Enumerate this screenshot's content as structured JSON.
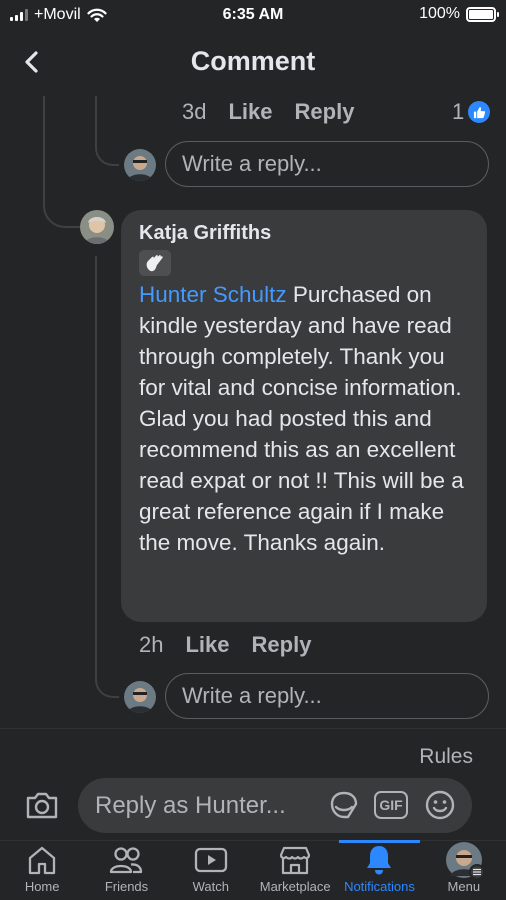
{
  "status_bar": {
    "carrier": "+Movil",
    "time": "6:35 AM",
    "battery": "100%"
  },
  "header": {
    "title": "Comment"
  },
  "prev_comment": {
    "time": "3d",
    "like_label": "Like",
    "reply_label": "Reply",
    "reaction_count": "1"
  },
  "reply_placeholder": "Write a reply...",
  "comment": {
    "author": "Katja Griffiths",
    "mention": "Hunter Schultz",
    "text": "Purchased on kindle yesterday and have read through completely. Thank you for vital and concise information. Glad you had posted this and recommend this as an excellent read expat or not !! This will be a great reference again if I make the move. Thanks again.",
    "time": "2h",
    "like_label": "Like",
    "reply_label": "Reply"
  },
  "rules_label": "Rules",
  "composer": {
    "placeholder": "Reply as Hunter...",
    "gif_label": "GIF"
  },
  "nav": [
    {
      "label": "Home",
      "icon": "home-icon"
    },
    {
      "label": "Friends",
      "icon": "friends-icon"
    },
    {
      "label": "Watch",
      "icon": "watch-icon"
    },
    {
      "label": "Marketplace",
      "icon": "marketplace-icon"
    },
    {
      "label": "Notifications",
      "icon": "bell-icon",
      "active": true
    },
    {
      "label": "Menu",
      "icon": "menu-avatar"
    }
  ],
  "colors": {
    "background": "#242526",
    "bubble": "#3a3b3c",
    "accent": "#2d88ff",
    "mention": "#4599ff",
    "muted": "#b0b3b8"
  }
}
